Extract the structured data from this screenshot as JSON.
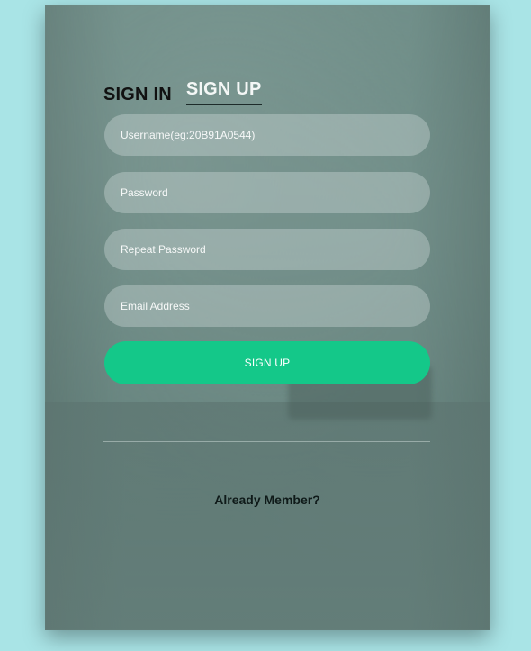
{
  "tabs": {
    "sign_in": "SIGN IN",
    "sign_up": "SIGN UP"
  },
  "form": {
    "username_placeholder": "Username(eg:20B91A0544)",
    "password_placeholder": "Password",
    "repeat_password_placeholder": "Repeat Password",
    "email_placeholder": "Email Address",
    "submit_label": "SIGN UP"
  },
  "footer": {
    "already_member": "Already Member?"
  },
  "colors": {
    "page_background": "#a9e4e6",
    "card_overlay": "#6a8a84",
    "accent_button": "#14c889",
    "active_tab_text": "#f4f7f6",
    "inactive_tab_text": "#111111"
  }
}
